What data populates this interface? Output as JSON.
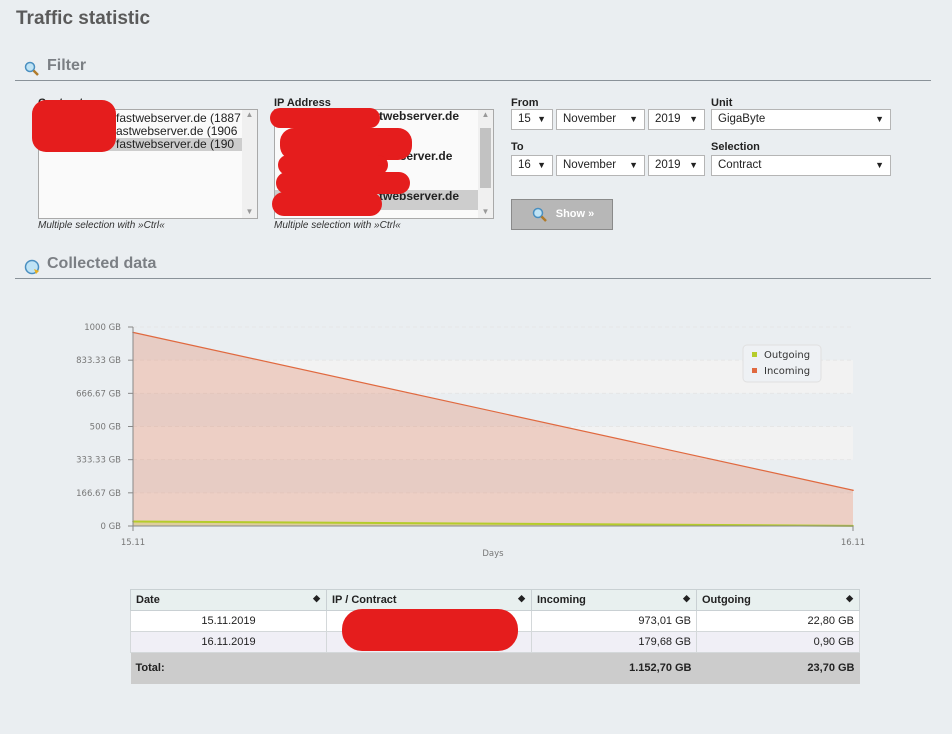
{
  "page_title": "Traffic statistic",
  "filter": {
    "title": "Filter",
    "contracts": {
      "label": "Contracts",
      "options": [
        "fastwebserver.de (1887",
        "astwebserver.de (1906",
        "fastwebserver.de (190"
      ],
      "hint": "Multiple selection with »Ctrl«"
    },
    "ip": {
      "label": "IP Address",
      "options": [
        "twebserver.de",
        "",
        "vebserver.de",
        "",
        "twebserver.de"
      ],
      "hint": "Multiple selection with »Ctrl«"
    },
    "from": {
      "label": "From",
      "day": "15",
      "month": "November",
      "year": "2019"
    },
    "to": {
      "label": "To",
      "day": "16",
      "month": "November",
      "year": "2019"
    },
    "unit": {
      "label": "Unit",
      "value": "GigaByte"
    },
    "selection": {
      "label": "Selection",
      "value": "Contract"
    },
    "show_label": "Show »"
  },
  "collected": {
    "title": "Collected data"
  },
  "chart_data": {
    "type": "area",
    "xlabel": "Days",
    "categories": [
      "15.11",
      "16.11"
    ],
    "ylim": [
      0,
      1000
    ],
    "yticks": [
      "0 GB",
      "166.67 GB",
      "333.33 GB",
      "500 GB",
      "666.67 GB",
      "833.33 GB",
      "1000 GB"
    ],
    "legend_position": "top-right",
    "series": [
      {
        "name": "Outgoing",
        "values": [
          22.8,
          0.9
        ],
        "color": "#b5cc2a"
      },
      {
        "name": "Incoming",
        "values": [
          973.01,
          179.68
        ],
        "color": "#e0693f"
      }
    ]
  },
  "table": {
    "headers": [
      "Date",
      "IP / Contract",
      "Incoming",
      "Outgoing"
    ],
    "rows": [
      {
        "date": "15.11.2019",
        "incoming": "973,01 GB",
        "outgoing": "22,80 GB"
      },
      {
        "date": "16.11.2019",
        "incoming": "179,68 GB",
        "outgoing": "0,90 GB"
      }
    ],
    "total": {
      "label": "Total:",
      "incoming": "1.152,70 GB",
      "outgoing": "23,70 GB"
    }
  }
}
